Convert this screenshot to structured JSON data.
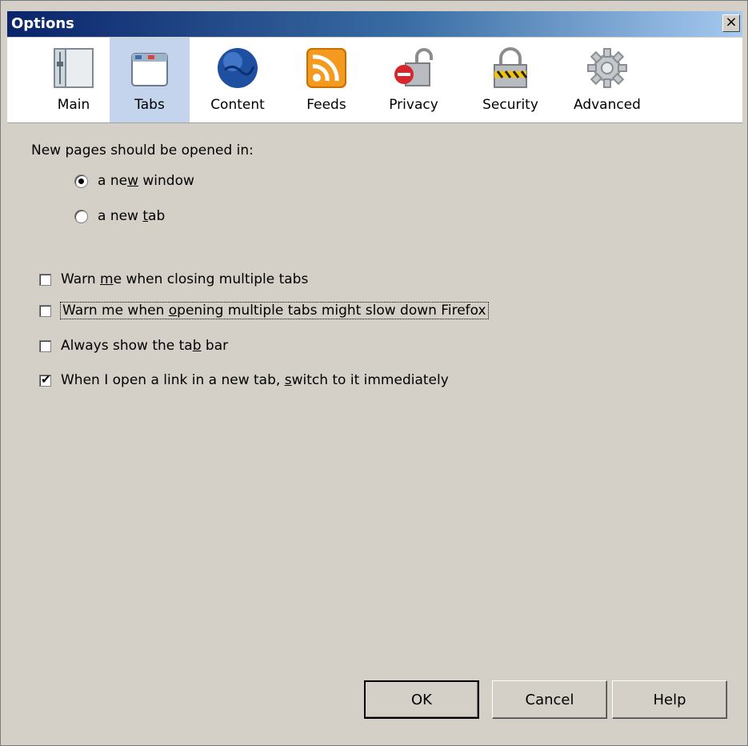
{
  "window": {
    "title": "Options",
    "close": "×"
  },
  "toolbar": {
    "panes": [
      {
        "label": "Main",
        "icon": "main-icon",
        "selected": false
      },
      {
        "label": "Tabs",
        "icon": "tabs-icon",
        "selected": true
      },
      {
        "label": "Content",
        "icon": "content-globe-icon",
        "selected": false
      },
      {
        "label": "Feeds",
        "icon": "feeds-rss-icon",
        "selected": false
      },
      {
        "label": "Privacy",
        "icon": "privacy-lock-icon",
        "selected": false
      },
      {
        "label": "Security",
        "icon": "security-padlock-icon",
        "selected": false
      },
      {
        "label": "Advanced",
        "icon": "advanced-gear-icon",
        "selected": false
      }
    ]
  },
  "tabs_pane": {
    "open_in_label": "New pages should be opened in:",
    "radio_new_window": {
      "pre": "a ne",
      "key": "w",
      "post": " window",
      "checked": true
    },
    "radio_new_tab": {
      "pre": "a new ",
      "key": "t",
      "post": "ab",
      "checked": false
    },
    "check_warn_closing": {
      "pre": "Warn ",
      "key": "m",
      "post": "e when closing multiple tabs",
      "checked": false
    },
    "check_warn_opening": {
      "pre": "Warn me when ",
      "key": "o",
      "post": "pening multiple tabs might slow down Firefox",
      "checked": false
    },
    "check_show_tabbar": {
      "pre": "Always show the ta",
      "key": "b",
      "post": " bar",
      "checked": false
    },
    "check_switch_new_tab": {
      "pre": "When I open a link in a new tab, ",
      "key": "s",
      "post": "witch to it immediately",
      "checked": true
    }
  },
  "buttons": {
    "ok": "OK",
    "cancel": "Cancel",
    "help": "Help"
  },
  "colors": {
    "selected_pane": "#c3d4ec",
    "titlebar_start": "#0a246a",
    "dialog_bg": "#d4d0c8"
  }
}
